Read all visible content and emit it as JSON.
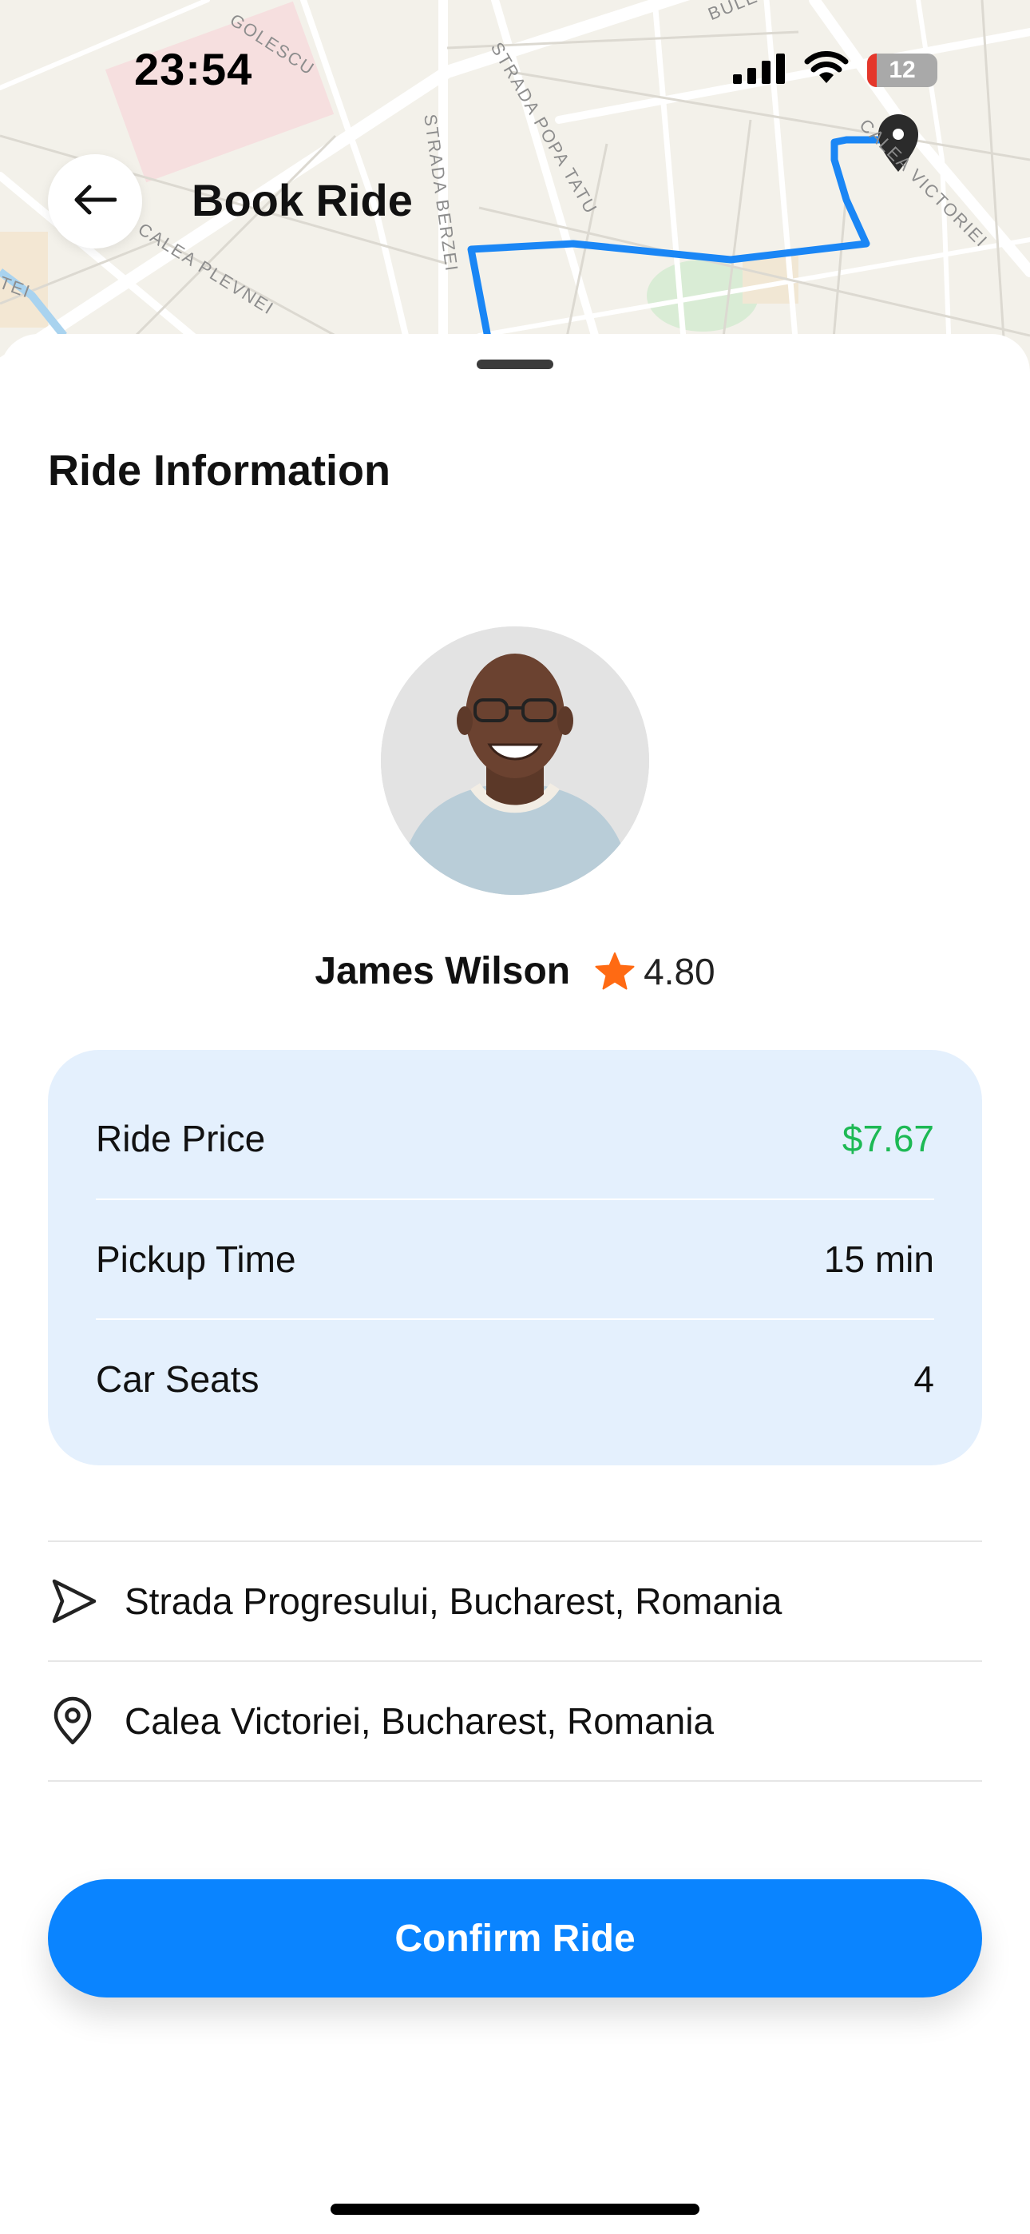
{
  "status_bar": {
    "time": "23:54",
    "battery_level": "12",
    "icons": [
      "signal-icon",
      "wifi-icon",
      "battery-icon"
    ]
  },
  "header": {
    "title": "Book Ride",
    "back_icon": "arrow-left-icon"
  },
  "map": {
    "street_labels": [
      "GOLESCU",
      "STRADA POPA TATU",
      "STRADA BERZEI",
      "CALEA VICTORIEI",
      "CALEA PLEVNEI",
      "BULE",
      "TEI"
    ],
    "route_color": "#1a86f5",
    "destination_icon": "map-pin-icon"
  },
  "sheet": {
    "section_title": "Ride Information",
    "driver": {
      "name": "James Wilson",
      "rating": "4.80",
      "rating_icon": "star-icon",
      "star_color": "#ff6a13"
    },
    "ride_info": [
      {
        "label": "Ride Price",
        "value": "$7.67"
      },
      {
        "label": "Pickup Time",
        "value": "15 min"
      },
      {
        "label": "Car Seats",
        "value": "4"
      }
    ],
    "locations": {
      "pickup": {
        "icon": "navigation-arrow-icon",
        "address": "Strada Progresului, Bucharest, Romania"
      },
      "destination": {
        "icon": "location-pin-icon",
        "address": "Calea Victoriei, Bucharest, Romania"
      }
    },
    "confirm_label": "Confirm Ride"
  },
  "colors": {
    "accent": "#0a84ff",
    "price_green": "#1db954",
    "card_bg": "#e4f0fd"
  }
}
